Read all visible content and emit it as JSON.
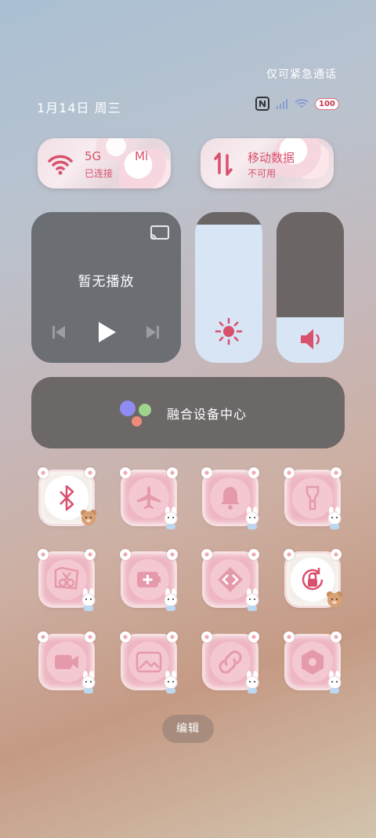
{
  "status": {
    "emergency_text": "仅可紧急通话",
    "date_text": "1月14日 周三",
    "battery": "100",
    "icons": [
      "nfc-icon",
      "signal-icon",
      "wifi-icon",
      "battery-icon"
    ]
  },
  "tiles": {
    "wifi": {
      "ssid_label": "5G",
      "status": "已连接",
      "extra": "Mi"
    },
    "mobile": {
      "label": "移动数据",
      "status": "不可用"
    }
  },
  "media": {
    "title": "暂无播放"
  },
  "fusion": {
    "label": "融合设备中心"
  },
  "quick_buttons": [
    {
      "icon": "bluetooth-icon",
      "active": true
    },
    {
      "icon": "airplane-icon",
      "active": false
    },
    {
      "icon": "bell-icon",
      "active": false
    },
    {
      "icon": "flashlight-icon",
      "active": false
    },
    {
      "icon": "screenshot-scissors-icon",
      "active": false
    },
    {
      "icon": "battery-saver-icon",
      "active": false
    },
    {
      "icon": "code-icon",
      "active": false
    },
    {
      "icon": "rotation-lock-icon",
      "active": true
    },
    {
      "icon": "screen-record-icon",
      "active": false
    },
    {
      "icon": "landscape-icon",
      "active": false
    },
    {
      "icon": "link-icon",
      "active": false
    },
    {
      "icon": "settings-hex-icon",
      "active": false
    }
  ],
  "edit_label": "编辑",
  "colors": {
    "accent": "#d9506d",
    "media_bg": "#6b6f74",
    "slider_fill": "#d7e5f4"
  }
}
